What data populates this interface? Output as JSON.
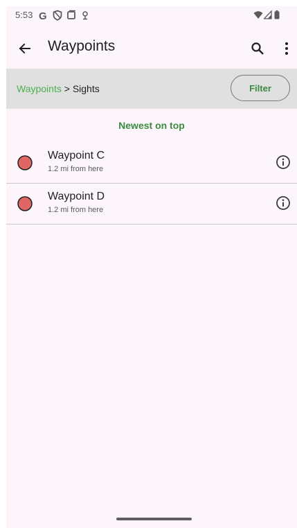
{
  "status_bar": {
    "time": "5:53",
    "left_icons": [
      "google-g-icon",
      "shield-icon",
      "square-icon",
      "location-pin-icon"
    ],
    "right_icons": [
      "wifi-icon",
      "cell-signal-icon",
      "battery-icon"
    ]
  },
  "app_bar": {
    "title": "Waypoints",
    "back_icon": "arrow-left-icon",
    "search_icon": "search-icon",
    "overflow_icon": "more-vertical-icon"
  },
  "breadcrumb": {
    "root": "Waypoints",
    "separator": " > ",
    "current": "Sights",
    "filter_label": "Filter"
  },
  "sort_header": "Newest on top",
  "waypoints": [
    {
      "title": "Waypoint C",
      "distance": "1.2 mi from here",
      "marker_color": "#e06666"
    },
    {
      "title": "Waypoint D",
      "distance": "1.2 mi from here",
      "marker_color": "#e06666"
    }
  ],
  "colors": {
    "accent_green": "#4caf50",
    "header_green": "#3b8a3f",
    "crumb_bar_bg": "#e0e0e0",
    "screen_bg": "#fcf6fc"
  }
}
